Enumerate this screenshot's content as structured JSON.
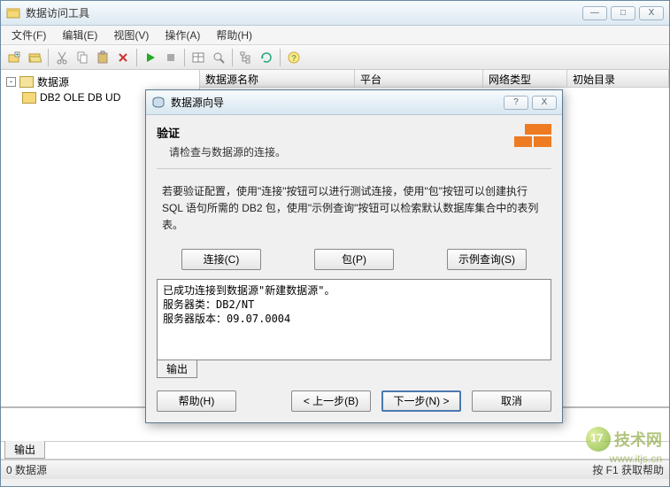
{
  "window": {
    "title": "数据访问工具",
    "controls": {
      "min": "—",
      "max": "□",
      "close": "X"
    }
  },
  "menubar": {
    "file": "文件(F)",
    "edit": "编辑(E)",
    "view": "视图(V)",
    "operate": "操作(A)",
    "help": "帮助(H)"
  },
  "tree": {
    "root": "数据源",
    "child1": "DB2 OLE DB UD"
  },
  "grid": {
    "cols": {
      "name": "数据源名称",
      "platform": "平台",
      "nettype": "网络类型",
      "initcat": "初始目录"
    }
  },
  "bottom": {
    "tab": "输出"
  },
  "status": {
    "left": "0 数据源",
    "right": "按 F1 获取帮助"
  },
  "dialog": {
    "title": "数据源向导",
    "help_close": "?",
    "close": "X",
    "heading": "验证",
    "subheading": "请检查与数据源的连接。",
    "desc": "若要验证配置，使用\"连接\"按钮可以进行测试连接，使用\"包\"按钮可以创建执行 SQL 语句所需的 DB2 包，使用\"示例查询\"按钮可以检索默认数据库集合中的表列表。",
    "buttons": {
      "connect": "连接(C)",
      "package": "包(P)",
      "sample": "示例查询(S)"
    },
    "output_lines": "已成功连接到数据源\"新建数据源\"。\n服务器类：DB2/NT\n服务器版本：09.07.0004",
    "output_tab": "输出",
    "footer": {
      "help": "帮助(H)",
      "back": "< 上一步(B)",
      "next": "下一步(N) >",
      "cancel": "取消"
    }
  },
  "watermark": {
    "brand": "技术网",
    "url": "www.itjs.cn"
  }
}
